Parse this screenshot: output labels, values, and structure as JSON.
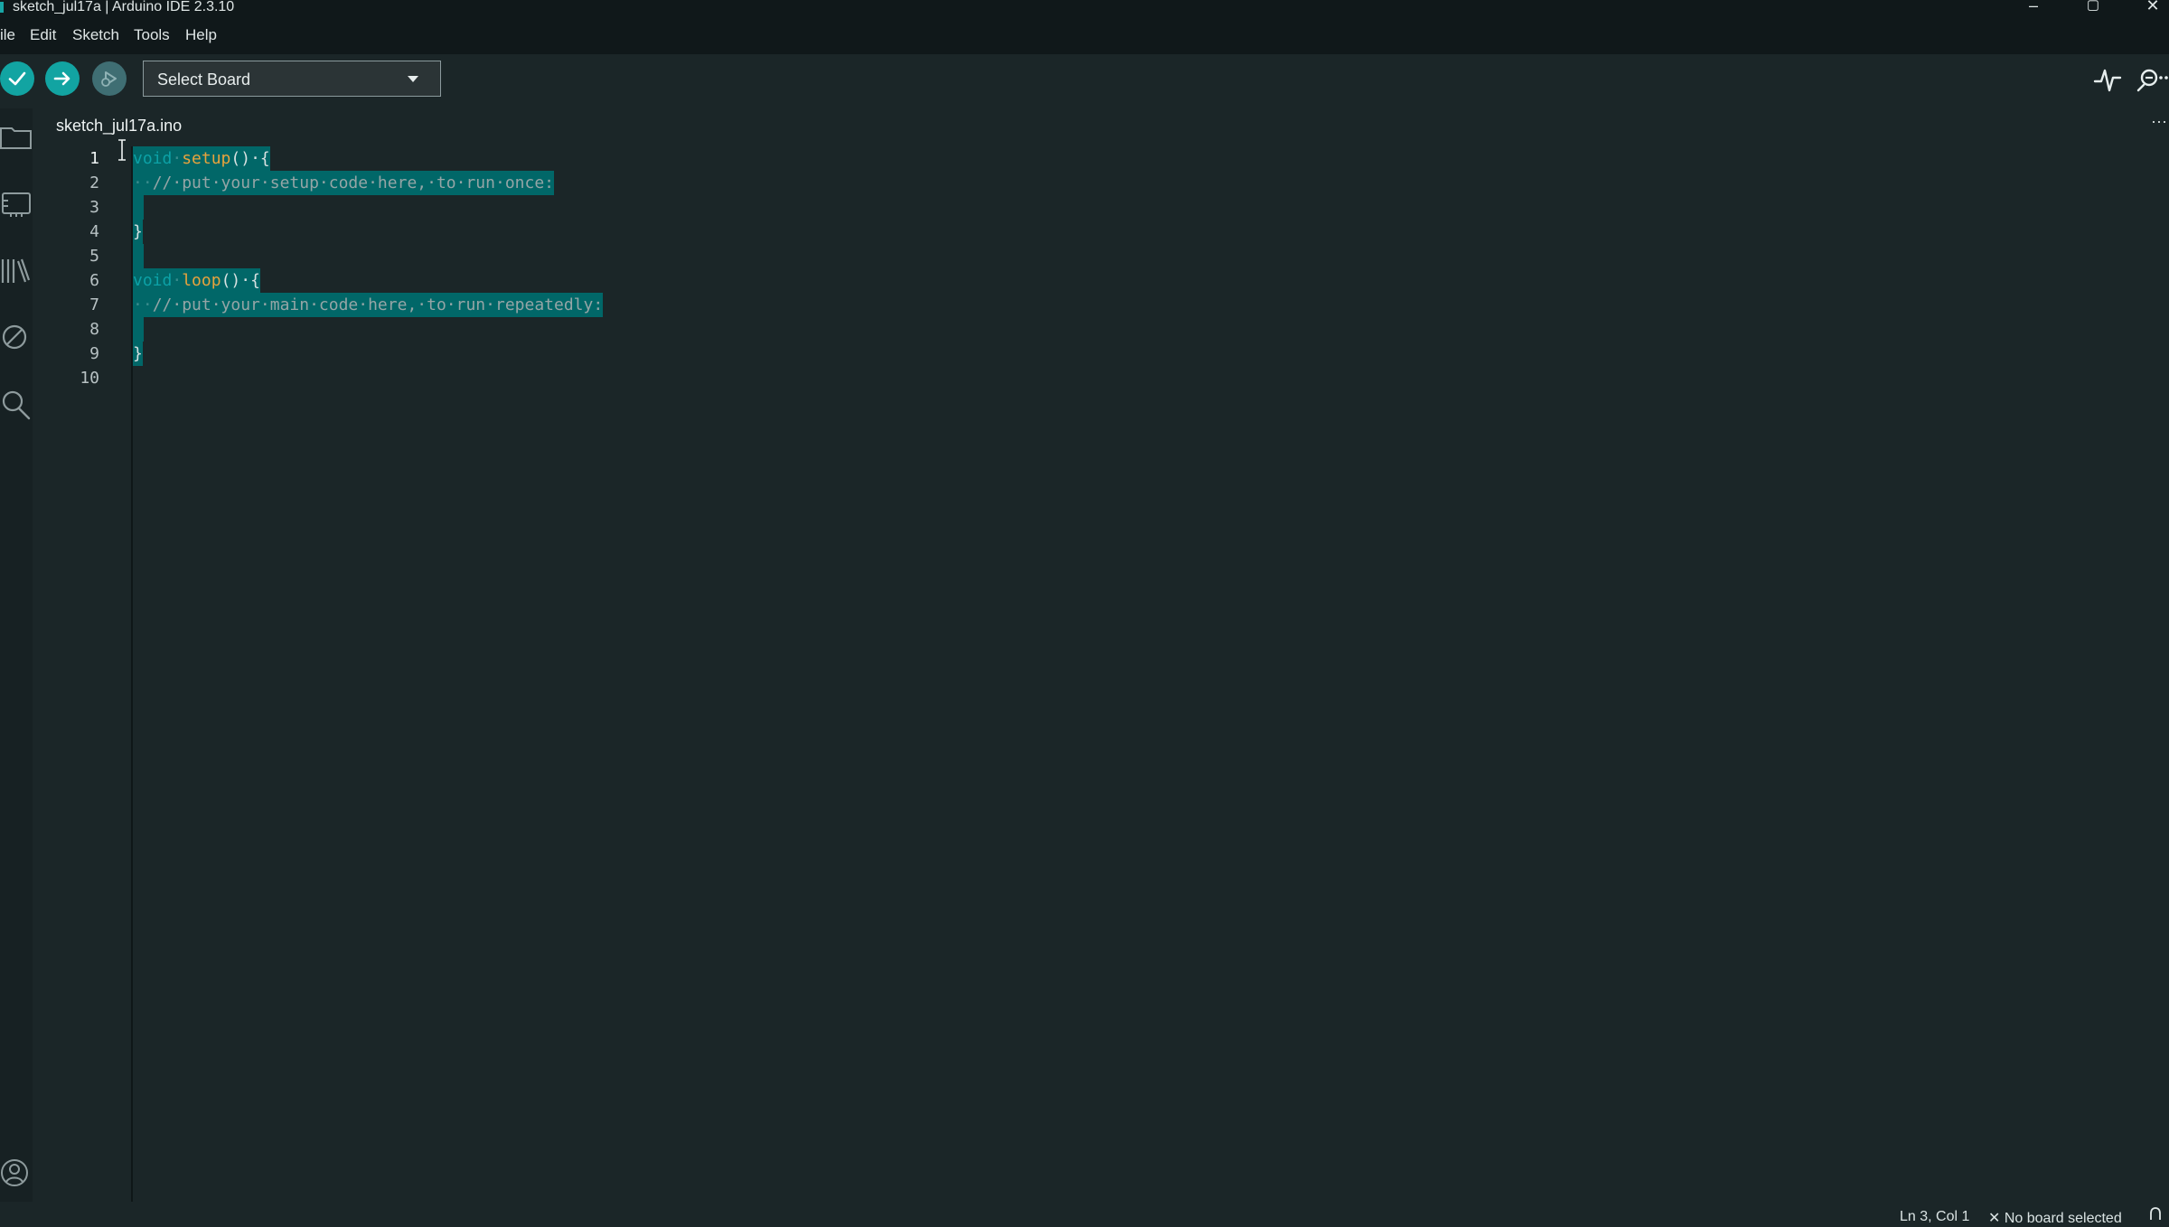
{
  "window": {
    "title": "sketch_jul17a | Arduino IDE 2.3.10",
    "minimize_glyph": "–",
    "restore_glyph": "▢",
    "close_glyph": "✕"
  },
  "menu": {
    "items": [
      "ile",
      "Edit",
      "Sketch",
      "Tools",
      "Help"
    ]
  },
  "toolbar": {
    "verify_icon": "check-icon",
    "upload_icon": "arrow-right-icon",
    "debug_icon": "debug-icon",
    "board_select_label": "Select Board",
    "serial_plotter_icon": "serial-plotter-icon",
    "serial_monitor_icon": "serial-monitor-icon"
  },
  "sidebar": {
    "icons": [
      "folder-icon",
      "boards-manager-icon",
      "library-icon",
      "debug-disabled-icon",
      "search-icon",
      "account-icon"
    ]
  },
  "editor": {
    "tab_label": "sketch_jul17a.ino",
    "more_glyph": "···",
    "line_numbers": [
      "1",
      "2",
      "3",
      "4",
      "5",
      "6",
      "7",
      "8",
      "9",
      "10"
    ],
    "code": {
      "l1_kw": "void",
      "l1_dot": "·",
      "l1_fn": "setup",
      "l1_rest": "()·{",
      "l2_ws": "··",
      "l2_comment": "//·put·your·setup·code·here,·to·run·once:",
      "l4": "}",
      "l6_kw": "void",
      "l6_dot": "·",
      "l6_fn": "loop",
      "l6_rest": "()·{",
      "l7_ws": "··",
      "l7_comment": "//·put·your·main·code·here,·to·run·repeatedly:",
      "l9": "}"
    }
  },
  "status": {
    "position": "Ln 3, Col 1",
    "board": "✕  No board selected"
  },
  "colors": {
    "accent": "#12a4a2",
    "selection": "#016768",
    "keyword": "#0ca1a6",
    "function": "#e7a33d",
    "comment": "#95a5a6",
    "background": "#1b2628"
  }
}
